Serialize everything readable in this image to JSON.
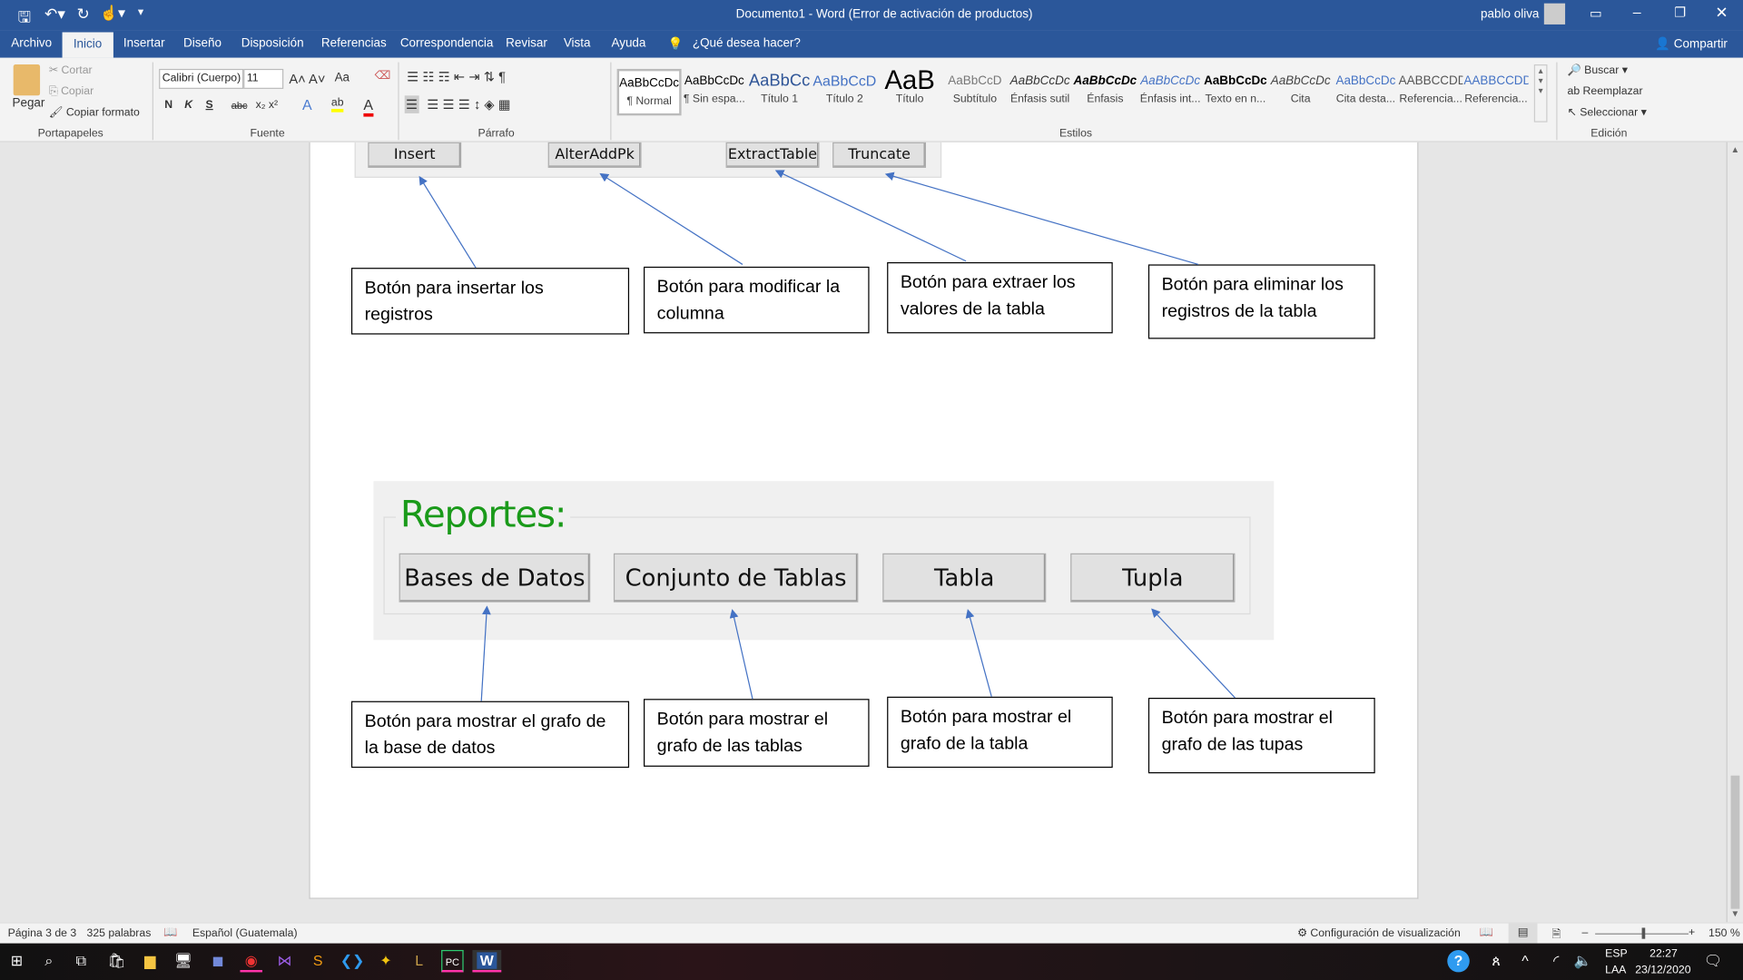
{
  "window": {
    "title": "Documento1  -  Word (Error de activación de productos)",
    "user": "pablo oliva",
    "share": "Compartir"
  },
  "tabs": [
    "Archivo",
    "Inicio",
    "Insertar",
    "Diseño",
    "Disposición",
    "Referencias",
    "Correspondencia",
    "Revisar",
    "Vista",
    "Ayuda"
  ],
  "tell_me": "¿Qué desea hacer?",
  "ribbon": {
    "clipboard": {
      "paste": "Pegar",
      "cut": "Cortar",
      "copy": "Copiar",
      "format_painter": "Copiar formato",
      "label": "Portapapeles"
    },
    "font": {
      "name": "Calibri (Cuerpo)",
      "size": "11",
      "label": "Fuente",
      "bold": "N",
      "italic": "K",
      "underline": "S",
      "strike": "abc",
      "case": "Aa"
    },
    "paragraph": {
      "label": "Párrafo"
    },
    "styles": {
      "label": "Estilos",
      "items": [
        {
          "preview": "AaBbCcDc",
          "name": "¶ Normal"
        },
        {
          "preview": "AaBbCcDc",
          "name": "¶ Sin espa..."
        },
        {
          "preview": "AaBbCc",
          "name": "Título 1"
        },
        {
          "preview": "AaBbCcD",
          "name": "Título 2"
        },
        {
          "preview": "AaB",
          "name": "Título"
        },
        {
          "preview": "AaBbCcD",
          "name": "Subtítulo"
        },
        {
          "preview": "AaBbCcDc",
          "name": "Énfasis sutil"
        },
        {
          "preview": "AaBbCcDc",
          "name": "Énfasis"
        },
        {
          "preview": "AaBbCcDc",
          "name": "Énfasis int..."
        },
        {
          "preview": "AaBbCcDc",
          "name": "Texto en n..."
        },
        {
          "preview": "AaBbCcDc",
          "name": "Cita"
        },
        {
          "preview": "AaBbCcDc",
          "name": "Cita desta..."
        },
        {
          "preview": "AABBCCDD",
          "name": "Referencia..."
        },
        {
          "preview": "AABBCCDD",
          "name": "Referencia..."
        }
      ]
    },
    "editing": {
      "find": "Buscar",
      "replace": "Reemplazar",
      "select": "Seleccionar",
      "label": "Edición"
    }
  },
  "document": {
    "top_buttons": [
      "Insert",
      "AlterAddPk",
      "ExtractTable",
      "Truncate"
    ],
    "top_callouts": [
      "Botón para insertar los registros",
      "Botón para modificar la columna",
      "Botón para extraer los valores de la tabla",
      "Botón para eliminar los registros de la tabla"
    ],
    "reports_title": "Reportes:",
    "report_buttons": [
      "Bases de Datos",
      "Conjunto de Tablas",
      "Tabla",
      "Tupla"
    ],
    "report_callouts": [
      "Botón para mostrar el grafo de la base de datos",
      "Botón para mostrar el grafo de las tablas",
      "Botón para mostrar el grafo de la tabla",
      "Botón para mostrar el grafo de las tupas"
    ],
    "colors": {
      "arrow": "#4472c4",
      "reports_title": "#1a9a1a"
    }
  },
  "status": {
    "page": "Página 3 de 3",
    "words": "325 palabras",
    "language": "Español (Guatemala)",
    "display_settings": "Configuración de visualización",
    "zoom": "150 %",
    "zoom_percent": 150
  },
  "taskbar": {
    "lang1": "ESP",
    "lang2": "LAA",
    "time": "22:27",
    "date": "23/12/2020"
  }
}
